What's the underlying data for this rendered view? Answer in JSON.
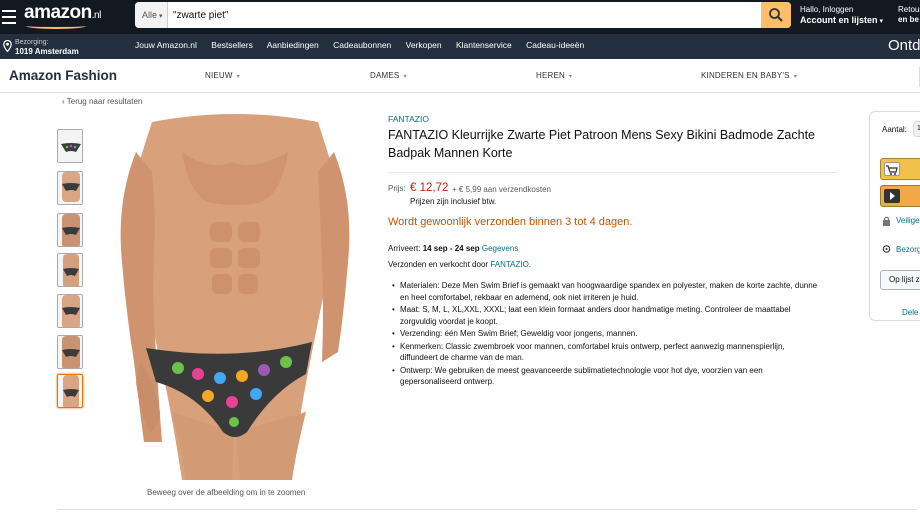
{
  "topbar": {
    "logo_text": "amazon",
    "logo_tld": ".nl",
    "search_category": "Alle",
    "search_value": "\"zwarte piet\"",
    "account_greeting": "Hallo, Inloggen",
    "account_lists": "Account en lijsten",
    "returns_line1": "Retour",
    "returns_line2": "en be"
  },
  "navbar": {
    "delivery_label": "Bezorging:",
    "delivery_city": "1019 Amsterdam",
    "links": [
      "Jouw Amazon.nl",
      "Bestsellers",
      "Aanbiedingen",
      "Cadeaubonnen",
      "Verkopen",
      "Klantenservice",
      "Cadeau-ideeën"
    ],
    "promo": "Ontd"
  },
  "fashion_nav": {
    "title": "Amazon Fashion",
    "items": [
      "NIEUW",
      "DAMES",
      "HEREN",
      "KINDEREN EN BABY'S"
    ]
  },
  "product": {
    "back_link": "‹ Terug naar resultaten",
    "image_caption": "Beweeg over de afbeelding om in te zoomen",
    "brand": "FANTAZIO",
    "title": "FANTAZIO Kleurrijke Zwarte Piet Patroon Mens Sexy Bikini Badmode Zachte Badpak Mannen Korte",
    "price_label": "Prijs:",
    "price": "€ 12,72",
    "shipping": "+ € 5,99 aan verzendkosten",
    "vat_note": "Prijzen zijn inclusief btw.",
    "usually_ships": "Wordt gewoonlijk verzonden binnen 3 tot 4 dagen.",
    "arrives_label": "Arriveert:",
    "arrives_dates": "14 sep - 24 sep",
    "arrives_link": "Gegevens",
    "sold_by_prefix": "Verzonden en verkocht door",
    "sold_by_seller": "FANTAZIO",
    "sold_by_suffix": ".",
    "bullets": [
      "Materialen: Deze Men Swim Brief is gemaakt van hoogwaardige spandex en polyester, maken de korte zachte, dunne en heel comfortabel, rekbaar en ademend, ook niet irriteren je huid.",
      "Maat: S, M, L, XL,XXL, XXXL; laat een klein formaat anders door handmatige meting. Controleer de maattabel zorgvuldig voordat je koopt.",
      "Verzending: één Men Swim Brief; Geweldig voor jongens, mannen.",
      "Kenmerken: Classic zwembroek voor mannen, comfortabel kruis ontwerp, perfect aanwezig mannenspierlijn, diffundeert de charme van de man.",
      "Ontwerp: We gebruiken de meest geavanceerde sublimatietechnologie voor hot dye, voorzien van een gepersonaliseerd ontwerp."
    ]
  },
  "buybox": {
    "qty_label": "Aantal:",
    "qty_value": "1",
    "secure_label": "Veilige",
    "ordered_label": "Bezorg",
    "list_button": "Op lijst z",
    "share_label": "Dele"
  },
  "colors": {
    "topbar": "#131921",
    "navbar": "#232f3e",
    "price": "#b12704",
    "link": "#007185",
    "ships": "#c45500",
    "add_to_cart": "#f0c14b",
    "buy_now": "#f3a847"
  }
}
